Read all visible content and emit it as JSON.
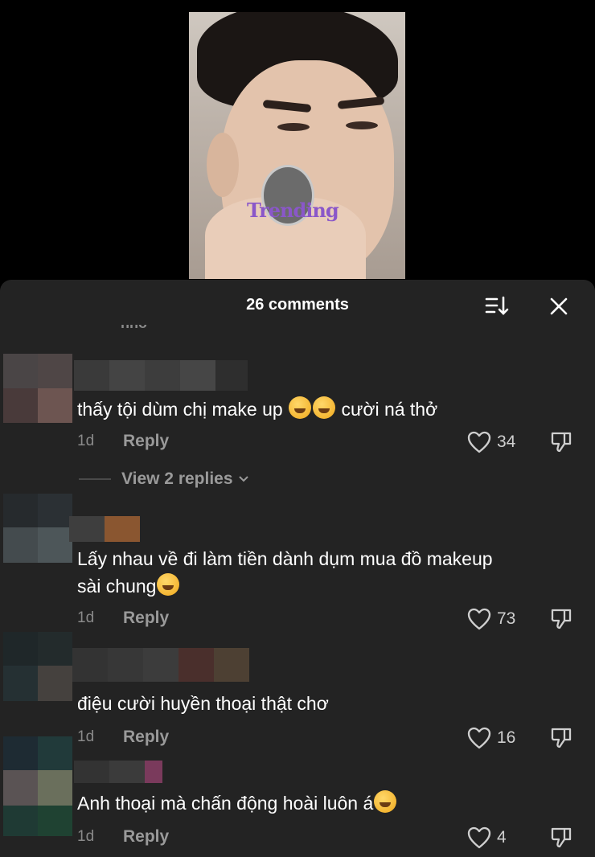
{
  "video": {
    "watermark": "Trending"
  },
  "sheet": {
    "title": "26 comments"
  },
  "comments": [
    {
      "text": "thấy tội dùm chị make up",
      "text_after": "cười ná thở",
      "emoji_count": 2,
      "age": "1d",
      "reply_label": "Reply",
      "likes": "34",
      "view_replies": "View 2 replies"
    },
    {
      "text": "Lấy nhau về đi làm tiền dành dụm mua đồ makeup",
      "text_line2": "sài chung",
      "emoji_count": 1,
      "age": "1d",
      "reply_label": "Reply",
      "likes": "73"
    },
    {
      "text": "điệu cười huyền thoại thật chơ",
      "age": "1d",
      "reply_label": "Reply",
      "likes": "16"
    },
    {
      "text": "Anh thoại mà chấn động hoài luôn á",
      "emoji_count": 1,
      "age": "1d",
      "reply_label": "Reply",
      "likes": "4"
    }
  ],
  "colors": {
    "sheet_bg": "#232323",
    "text": "#ffffff",
    "muted": "#8a8a8a"
  },
  "icons": [
    "sort-icon",
    "close-icon",
    "heart-icon",
    "dislike-icon",
    "chevron-down-icon",
    "laughing-emoji-icon",
    "sweat-smile-emoji-icon"
  ]
}
